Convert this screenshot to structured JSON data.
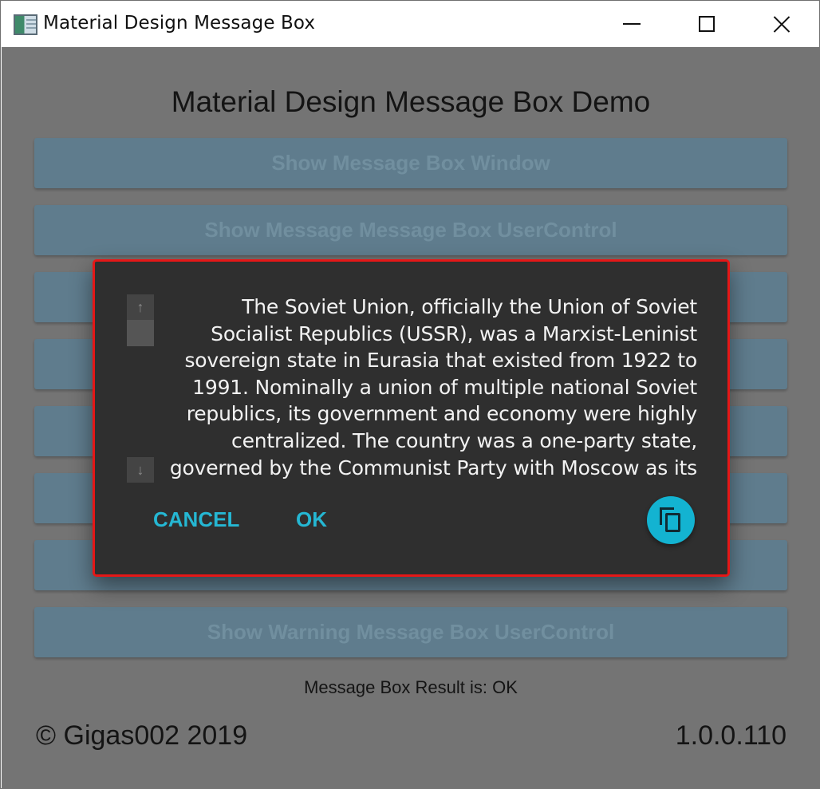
{
  "window": {
    "title": "Material Design Message Box",
    "icons": {
      "app": "app-window-icon",
      "minimize": "minimize-icon",
      "maximize": "maximize-icon",
      "close": "close-icon"
    }
  },
  "main": {
    "heading": "Material Design Message Box Demo",
    "buttons": [
      {
        "label": "Show Message Box Window"
      },
      {
        "label": "Show Message Message Box UserControl"
      },
      {
        "label": ""
      },
      {
        "label": ""
      },
      {
        "label": ""
      },
      {
        "label": ""
      },
      {
        "label": ""
      },
      {
        "label": "Show Warning Message Box UserControl"
      }
    ],
    "result_text": "Message Box Result is: OK",
    "copyright": "© Gigas002 2019",
    "version": "1.0.0.110"
  },
  "dialog": {
    "message": "The Soviet Union, officially the Union of Soviet Socialist Republics (USSR), was a Marxist-Leninist sovereign state in Eurasia that existed from 1922 to 1991. Nominally a union of multiple national Soviet republics, its government and economy were highly centralized. The country was a one-party state, governed by the Communist Party with Moscow as its",
    "cancel_label": "CANCEL",
    "ok_label": "OK",
    "scroll_up_glyph": "↑",
    "scroll_down_glyph": "↓",
    "copy_icon": "copy-icon",
    "accent_color": "#25b7d3",
    "border_color": "#e51717"
  }
}
